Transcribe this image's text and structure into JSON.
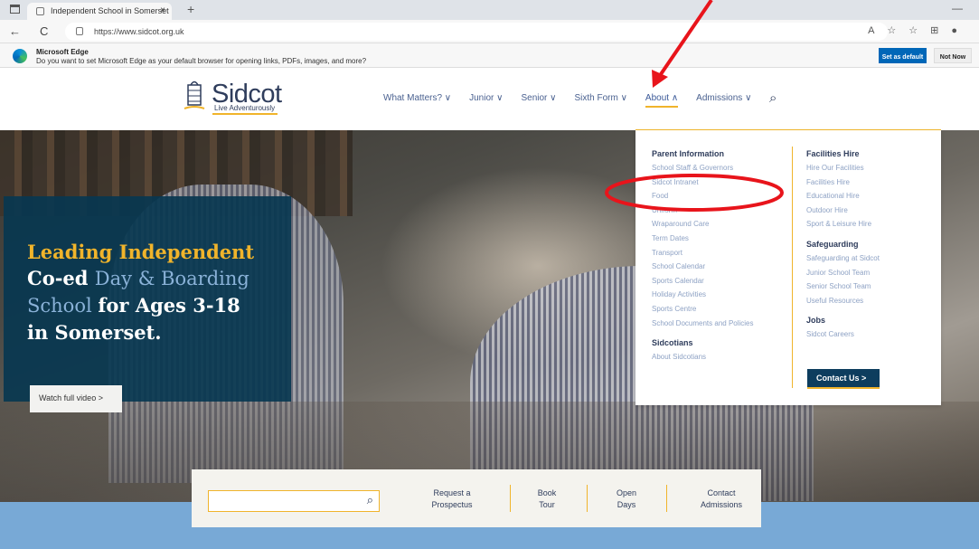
{
  "browser": {
    "tab_title": "Independent School in Somerset",
    "tab_close": "×",
    "new_tab": "+",
    "url": "https://www.sidcot.org.uk",
    "back": "←",
    "refresh": "C",
    "minimize": "—"
  },
  "edge_bar": {
    "title": "Microsoft Edge",
    "message": "Do you want to set Microsoft Edge as your default browser for opening links, PDFs, images, and more?",
    "set_default": "Set as default",
    "not_now": "Not Now"
  },
  "site": {
    "logo_name": "Sidcot",
    "logo_tagline": "Live Adventurously",
    "nav": [
      {
        "label": "What Matters? ∨"
      },
      {
        "label": "Junior ∨"
      },
      {
        "label": "Senior ∨"
      },
      {
        "label": "Sixth Form ∨"
      },
      {
        "label": "About ∧"
      },
      {
        "label": "Admissions ∨"
      }
    ],
    "search_icon": "⌕"
  },
  "hero": {
    "line1": "Leading Independent",
    "line2a": "Co-ed ",
    "line2b": "Day & Boarding",
    "line3a": "School ",
    "line3b": "for Ages 3-18",
    "line4": "in Somerset.",
    "watch_label": "Watch full video  >"
  },
  "quick_links": {
    "request": [
      "Request a",
      "Prospectus"
    ],
    "book": [
      "Book",
      "Tour"
    ],
    "open": [
      "Open",
      "Days"
    ],
    "contact": [
      "Contact",
      "Admissions"
    ]
  },
  "dropdown": {
    "col1_heading": "Parent Information",
    "col1_items": [
      "School Staff & Governors",
      "Sidcot Intranet",
      "Food",
      "Uniform",
      "Wraparound Care",
      "Term Dates",
      "Transport",
      "School Calendar",
      "Sports Calendar",
      "Holiday Activities",
      "Sports Centre",
      "School Documents and Policies"
    ],
    "col1_heading2": "Sidcotians",
    "col1_items2": [
      "About Sidcotians"
    ],
    "col2_heading": "Facilities Hire",
    "col2_items": [
      "Hire Our Facilities",
      "Facilities Hire",
      "Educational Hire",
      "Outdoor Hire",
      "Sport & Leisure Hire"
    ],
    "col2_heading2": "Safeguarding",
    "col2_items2": [
      "Safeguarding at Sidcot",
      "Junior School Team",
      "Senior School Team",
      "Useful Resources"
    ],
    "col2_heading3": "Jobs",
    "col2_items3": [
      "Sidcot Careers"
    ],
    "contact_button": "Contact Us  >"
  },
  "colors": {
    "gold": "#f0b42b",
    "navy": "#2f3d5c",
    "annotation_red": "#e8141b",
    "edge_blue": "#0067b8"
  }
}
